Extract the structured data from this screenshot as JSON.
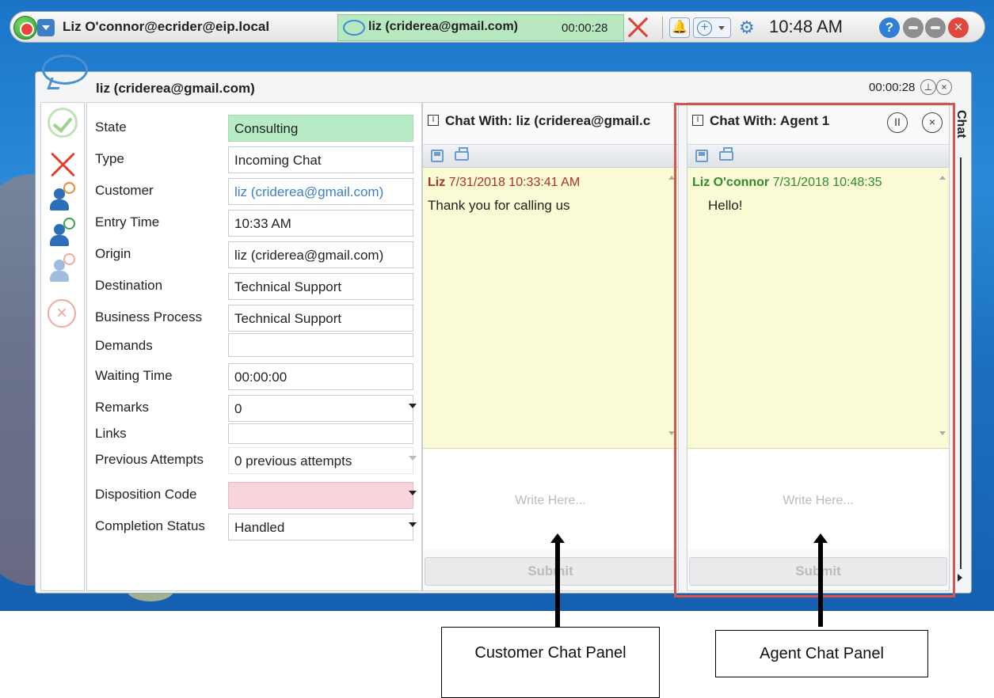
{
  "toolbar": {
    "agent": "Liz O'connor@ecrider@eip.local",
    "session_label": "liz (criderea@gmail.com)",
    "session_timer": "00:00:28",
    "clock": "10:48 AM",
    "help_glyph": "?",
    "close_glyph": "×",
    "plus_glyph": "+",
    "bell_glyph": "🔔",
    "gear_glyph": "⚙"
  },
  "window": {
    "title": "liz (criderea@gmail.com)",
    "timer": "00:00:28",
    "pin_glyph": "⊥",
    "close_glyph": "×",
    "cancel_glyph": "×"
  },
  "details": [
    {
      "label": "State",
      "value": "Consulting"
    },
    {
      "label": "Type",
      "value": "Incoming Chat"
    },
    {
      "label": "Customer",
      "value": "liz (criderea@gmail.com)"
    },
    {
      "label": "Entry Time",
      "value": "10:33 AM"
    },
    {
      "label": "Origin",
      "value": "liz (criderea@gmail.com)"
    },
    {
      "label": "Destination",
      "value": "Technical Support"
    },
    {
      "label": "Business Process",
      "value": "Technical Support"
    },
    {
      "label": "Demands",
      "value": ""
    },
    {
      "label": "Waiting Time",
      "value": "00:00:00"
    },
    {
      "label": "Remarks",
      "value": "0"
    },
    {
      "label": "Links",
      "value": ""
    },
    {
      "label": "Previous Attempts",
      "value": "0 previous attempts"
    },
    {
      "label": "Disposition Code",
      "value": ""
    },
    {
      "label": "Completion Status",
      "value": "Handled"
    }
  ],
  "customer_chat": {
    "title": "Chat With: liz (criderea@gmail.c",
    "message": {
      "sender": "Liz",
      "timestamp": "7/31/2018 10:33:41 AM",
      "text": "Thank you for calling us"
    },
    "placeholder": "Write Here...",
    "submit_label": "Submit",
    "toggle_glyph": "I"
  },
  "agent_chat": {
    "title": "Chat With: Agent 1",
    "message": {
      "sender": "Liz O'connor",
      "timestamp": "7/31/2018 10:48:35",
      "text": "Hello!"
    },
    "placeholder": "Write Here...",
    "submit_label": "Submit",
    "toggle_glyph": "I",
    "pause_glyph": "II",
    "close_glyph": "×"
  },
  "side_tab": {
    "label": "Chat"
  },
  "annotations": {
    "customer_panel": "Customer Chat Panel",
    "agent_panel": "Agent Chat Panel"
  },
  "colors": {
    "state_bg": "#b6ebc5",
    "customer_sender": "#a8322a",
    "agent_sender": "#2e8b2e",
    "highlight": "#d9534f"
  }
}
